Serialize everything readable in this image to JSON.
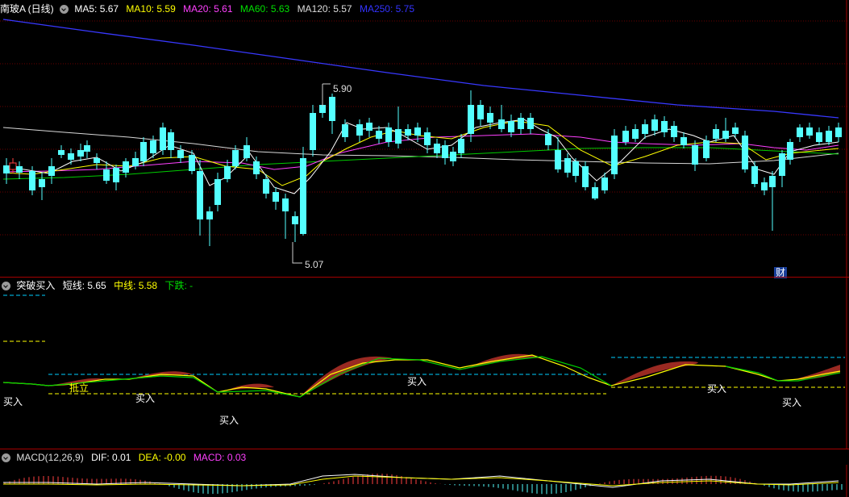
{
  "header": {
    "title": "南玻A (日线)",
    "ma": [
      {
        "label": "MA5: 5.67",
        "color": "#ffffff"
      },
      {
        "label": "MA10: 5.59",
        "color": "#ffff00"
      },
      {
        "label": "MA20: 5.61",
        "color": "#ff40ff"
      },
      {
        "label": "MA60: 5.63",
        "color": "#00e000"
      },
      {
        "label": "MA120: 5.57",
        "color": "#dcdcdc"
      },
      {
        "label": "MA250: 5.75",
        "color": "#3333ff"
      }
    ]
  },
  "price_chart": {
    "high_label": "5.90",
    "low_label": "5.07",
    "badge": "财"
  },
  "indicator": {
    "name": "突破买入",
    "short": "短线: 5.65",
    "mid": "中线: 5.58",
    "down": "下跌: -",
    "colors": {
      "short": "#ffffff",
      "mid": "#ffff00",
      "down": "#00e000"
    },
    "annotations": [
      "买入",
      "抵立",
      "买入",
      "买入",
      "买入",
      "买入",
      "买入"
    ]
  },
  "macd": {
    "name": "MACD(12,26,9)",
    "dif": "DIF: 0.01",
    "dea": "DEA: -0.00",
    "macd": "MACD: 0.03",
    "colors": {
      "dif": "#ffffff",
      "dea": "#ffff00",
      "macd": "#ff40ff"
    }
  },
  "colors": {
    "up": "#ff4040",
    "down": "#54ffff",
    "grid": "#7a0000",
    "divider": "#a40000"
  }
}
